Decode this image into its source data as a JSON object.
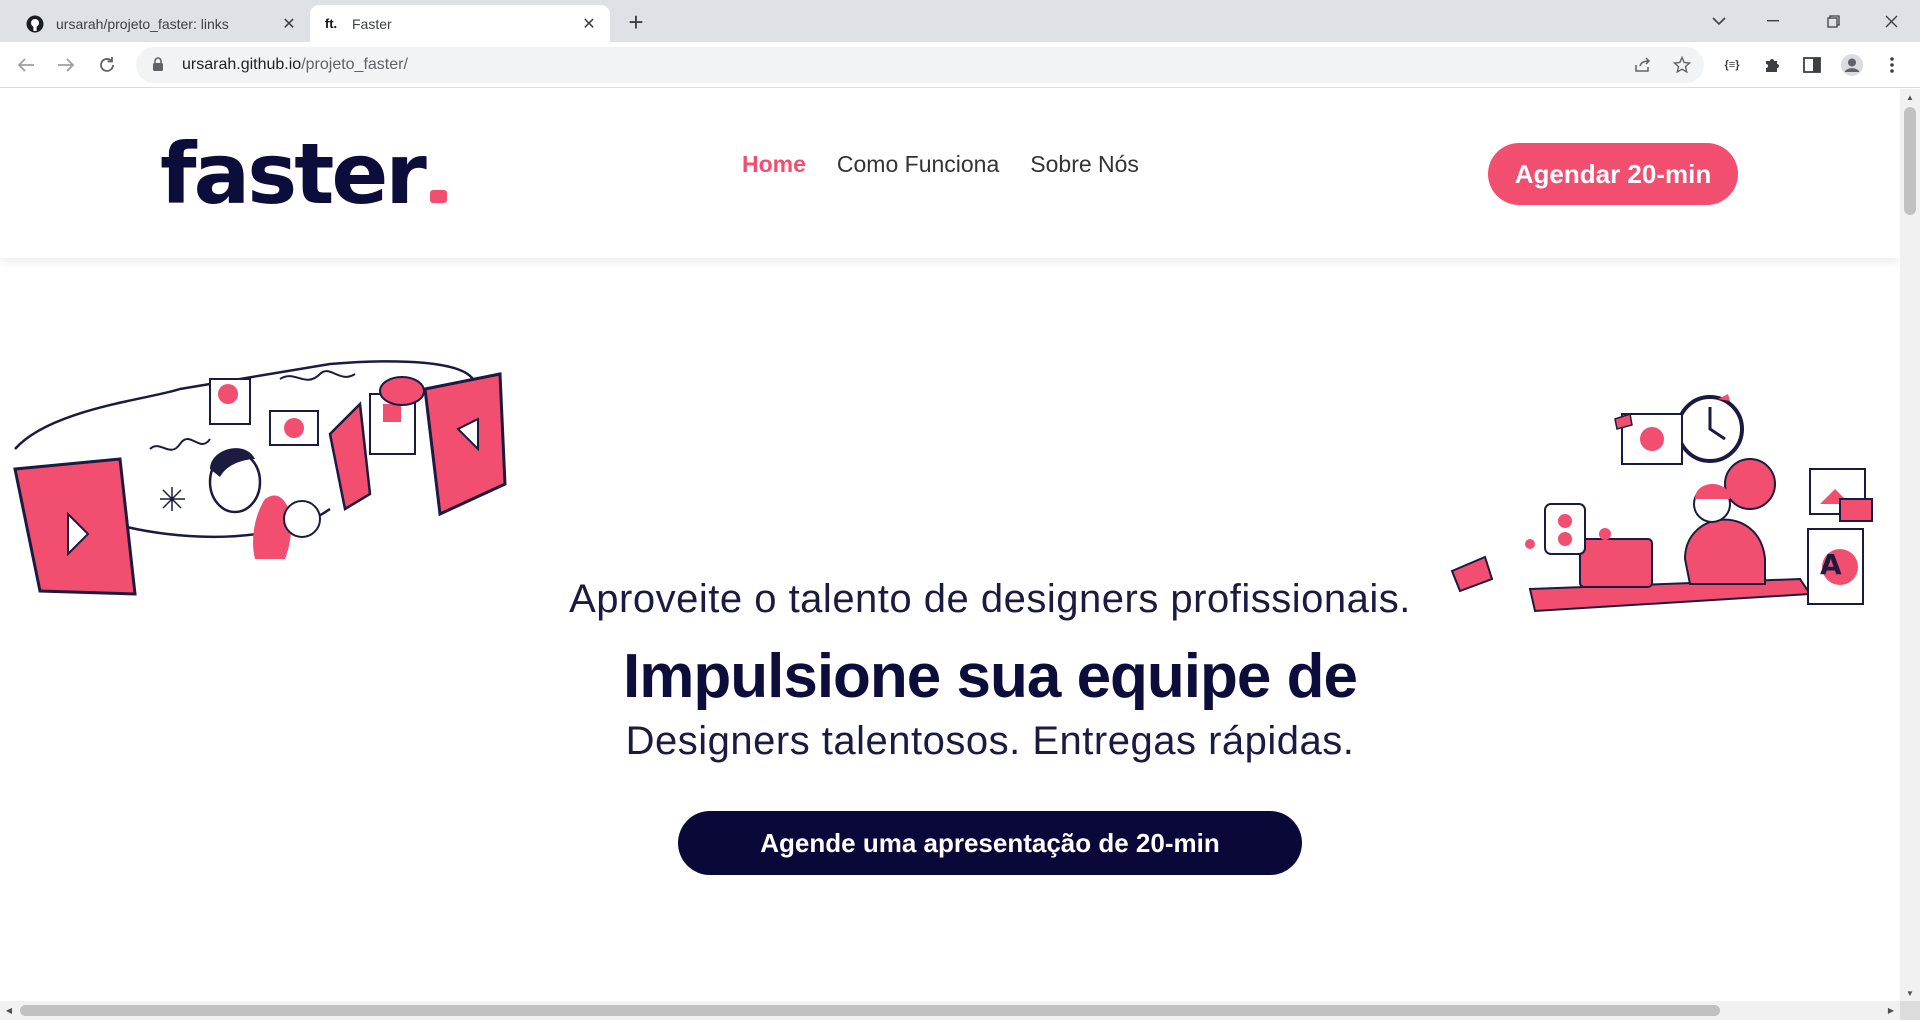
{
  "browser": {
    "tabs": [
      {
        "title": "ursarah/projeto_faster: links",
        "favicon": "github-icon",
        "active": false
      },
      {
        "title": "Faster",
        "favicon": "ft.",
        "active": true
      }
    ],
    "new_tab": "+",
    "url_domain": "ursarah.github.io",
    "url_path": "/projeto_faster/"
  },
  "site": {
    "logo": "faster",
    "nav": [
      "Home",
      "Como Funciona",
      "Sobre Nós"
    ],
    "header_cta": "Agendar 20-min",
    "hero": {
      "subtitle": "Aproveite o talento de designers profissionais.",
      "title": "Impulsione sua equipe de",
      "tagline": "Designers talentosos. Entregas rápidas.",
      "cta": "Agende uma apresentação de 20-min"
    }
  },
  "colors": {
    "brand_pink": "#f24e6f",
    "brand_navy": "#0d0d3b",
    "cta_dark": "#0a0838"
  }
}
